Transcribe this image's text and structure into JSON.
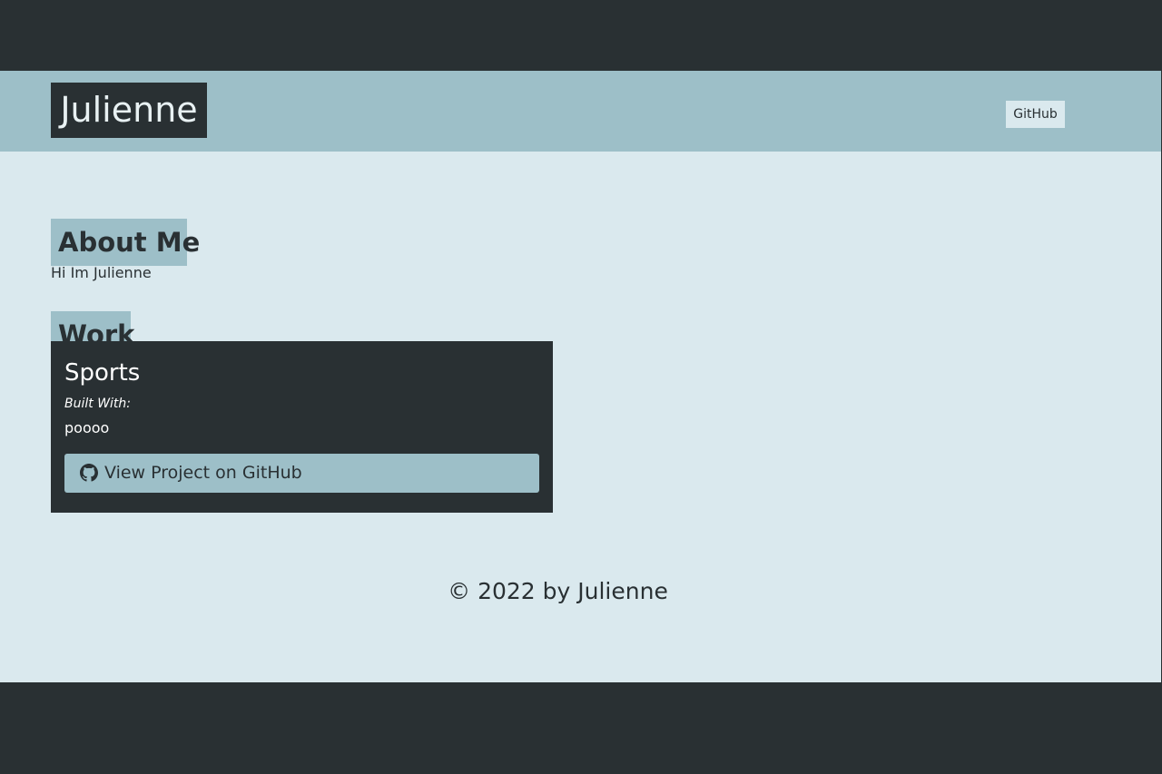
{
  "header": {
    "brand": "Julienne",
    "nav": {
      "github_label": "GitHub"
    }
  },
  "about": {
    "heading": "About Me",
    "text": "Hi Im Julienne"
  },
  "work": {
    "heading": "Work",
    "projects": [
      {
        "title": "Sports",
        "built_with_label": "Built With:",
        "built_with_value": "poooo",
        "button_label": "View Project on GitHub",
        "button_icon": "github-icon"
      }
    ]
  },
  "footer": {
    "copyright": "© 2022 by Julienne"
  },
  "colors": {
    "dark": "#293033",
    "accent": "#9dbfc8",
    "background": "#dae9ee",
    "text_light": "#ffffff"
  }
}
